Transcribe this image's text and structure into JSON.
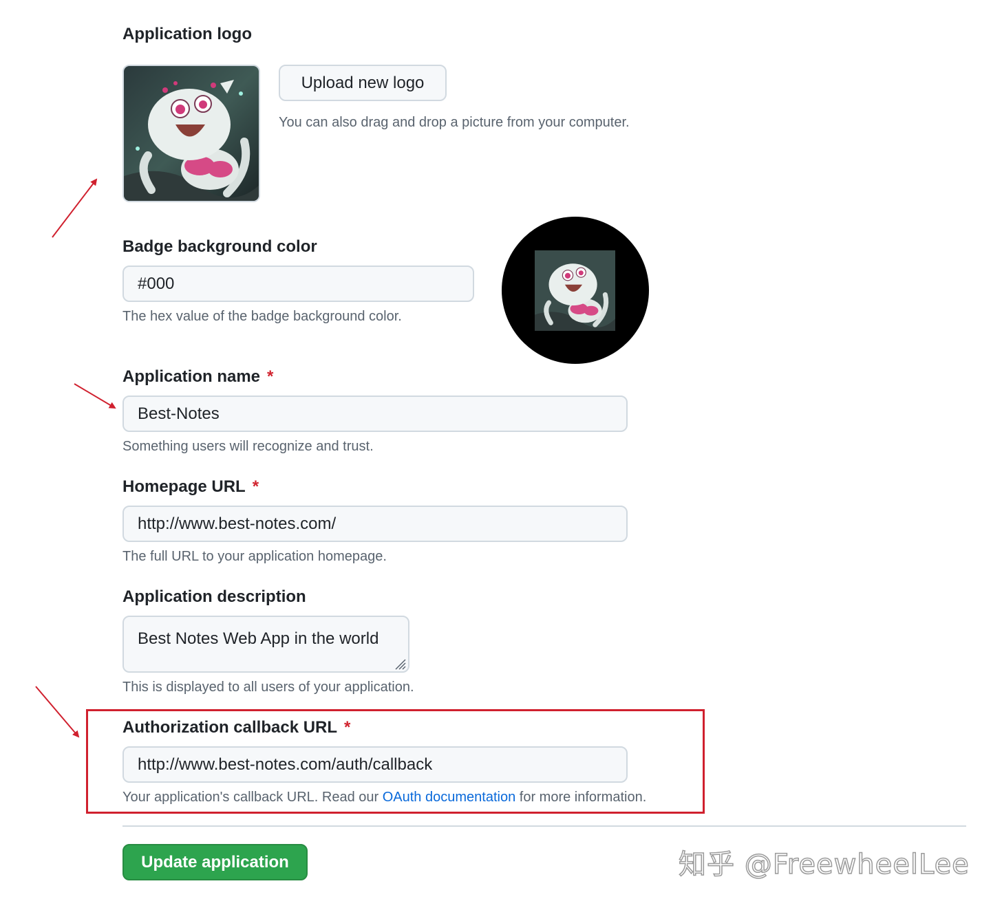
{
  "logo_section": {
    "label": "Application logo",
    "upload_button": "Upload new logo",
    "drag_hint": "You can also drag and drop a picture from your computer."
  },
  "badge_section": {
    "label": "Badge background color",
    "value": "#000",
    "hint": "The hex value of the badge background color."
  },
  "app_name": {
    "label": "Application name",
    "required": "*",
    "value": "Best-Notes",
    "hint": "Something users will recognize and trust."
  },
  "homepage": {
    "label": "Homepage URL",
    "required": "*",
    "value": "http://www.best-notes.com/",
    "hint": "The full URL to your application homepage."
  },
  "description": {
    "label": "Application description",
    "value": "Best Notes Web App in the world",
    "hint": "This is displayed to all users of your application."
  },
  "callback": {
    "label": "Authorization callback URL",
    "required": "*",
    "value": "http://www.best-notes.com/auth/callback",
    "hint_before": "Your application's callback URL. Read our ",
    "hint_link": "OAuth documentation",
    "hint_after": " for more information."
  },
  "submit": {
    "label": "Update application"
  },
  "watermark": "知乎 @FreewheelLee",
  "colors": {
    "primary_button": "#2da44e",
    "link": "#0969da",
    "required_mark": "#d1242f",
    "annotation_red": "#d0202e",
    "badge_background": "#000000"
  }
}
